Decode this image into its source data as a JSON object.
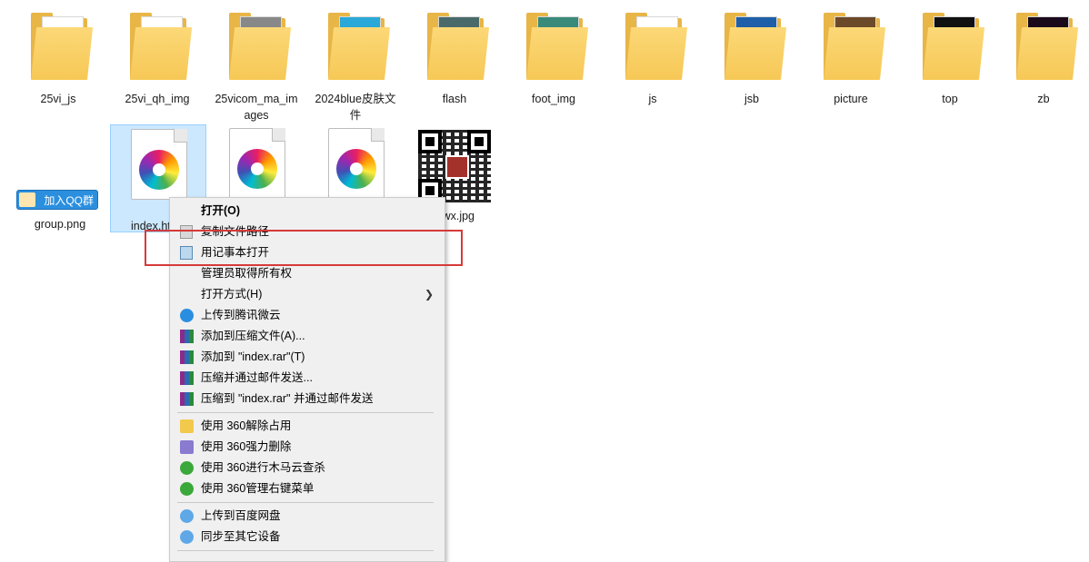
{
  "folders": [
    {
      "label": "25vi_js"
    },
    {
      "label": "25vi_qh_img"
    },
    {
      "label": "25vicom_ma_images"
    },
    {
      "label": "2024blue皮肤文件"
    },
    {
      "label": "flash"
    },
    {
      "label": "foot_img"
    },
    {
      "label": "js"
    },
    {
      "label": "jsb"
    },
    {
      "label": "picture"
    },
    {
      "label": "top"
    },
    {
      "label": "zb"
    }
  ],
  "files": {
    "group": {
      "label": "group.png",
      "button_text": "加入QQ群"
    },
    "index": {
      "label": "index.ht"
    },
    "qr": {
      "label": "wx.jpg"
    }
  },
  "context_menu": {
    "items": [
      {
        "label": "打开(O)"
      },
      {
        "label": "复制文件路径"
      },
      {
        "label": "用记事本打开"
      },
      {
        "label": "管理员取得所有权"
      },
      {
        "label": "打开方式(H)",
        "submenu_arrow": "❯"
      },
      {
        "label": "上传到腾讯微云"
      },
      {
        "label": "添加到压缩文件(A)..."
      },
      {
        "label": "添加到 \"index.rar\"(T)"
      },
      {
        "label": "压缩并通过邮件发送..."
      },
      {
        "label": "压缩到 \"index.rar\" 并通过邮件发送"
      },
      {
        "label": "使用 360解除占用"
      },
      {
        "label": "使用 360强力删除"
      },
      {
        "label": "使用 360进行木马云查杀"
      },
      {
        "label": "使用 360管理右键菜单"
      },
      {
        "label": "上传到百度网盘"
      },
      {
        "label": "同步至其它设备"
      }
    ]
  },
  "colors": {
    "highlight": "#d63a3a",
    "selection": "#cce8ff"
  }
}
